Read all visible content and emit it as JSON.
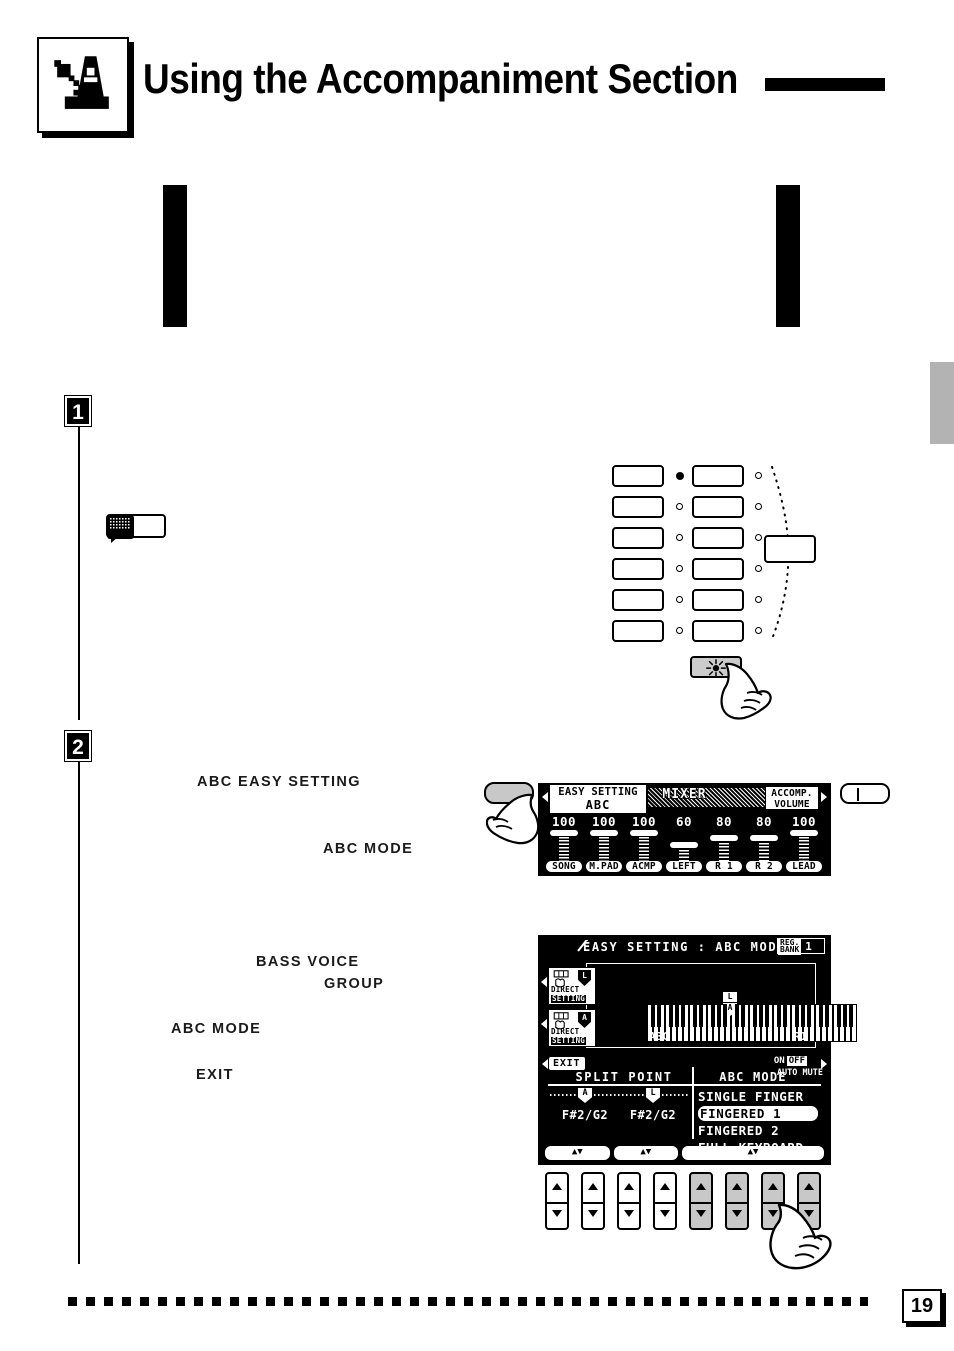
{
  "header": {
    "title": "Using the Accompaniment Section",
    "icon": "metronome-icon"
  },
  "footer": {
    "page_number": "19"
  },
  "steps": [
    {
      "number": "1"
    },
    {
      "number": "2"
    }
  ],
  "labels": {
    "abc_easy_setting": "ABC EASY SETTING",
    "abc_mode_1": "ABC MODE",
    "bass_voice": "BASS VOICE",
    "group": "GROUP",
    "abc_mode_2": "ABC MODE",
    "exit": "EXIT"
  },
  "mixer_lcd": {
    "title": "MIXER",
    "easy_setting": {
      "line1": "EASY SETTING",
      "line2": "ABC"
    },
    "accomp_volume": {
      "line1": "ACCOMP.",
      "line2": "VOLUME"
    },
    "channels": [
      {
        "name": "SONG",
        "value": "100"
      },
      {
        "name": "M.PAD",
        "value": "100"
      },
      {
        "name": "ACMP",
        "value": "100"
      },
      {
        "name": "LEFT",
        "value": "60"
      },
      {
        "name": "R 1",
        "value": "80"
      },
      {
        "name": "R 2",
        "value": "80"
      },
      {
        "name": "LEAD",
        "value": "100"
      }
    ]
  },
  "easy_setting_lcd": {
    "title": "EASY SETTING : ABC MODE",
    "reg_bank": {
      "label_line1": "REG.",
      "label_line2": "BANK",
      "value": "1"
    },
    "direct_setting_top": {
      "line1": "DIRECT",
      "line2": "SETTING",
      "marker": "L"
    },
    "direct_setting_bottom": {
      "line1": "DIRECT",
      "line2": "SETTING",
      "marker": "A"
    },
    "keyboard": {
      "split_marker_top": "L",
      "split_marker_bottom": "A",
      "left_zone_label": "ABC",
      "right_zone_label": "R1"
    },
    "exit_button": "EXIT",
    "auto_mute": {
      "on": "ON",
      "off": "OFF",
      "label": "AUTO MUTE"
    },
    "split_point": {
      "heading": "SPLIT POINT",
      "columns": [
        {
          "flag": "A",
          "note": "F#2/G2"
        },
        {
          "flag": "L",
          "note": "F#2/G2"
        }
      ]
    },
    "abc_mode": {
      "heading": "ABC MODE",
      "options": [
        "SINGLE FINGER",
        "FINGERED 1",
        "FINGERED 2",
        "FULL KEYBOARD"
      ],
      "selected": "FINGERED 1"
    },
    "button_strip": [
      "▲▼",
      "▲▼",
      "▲▼"
    ]
  },
  "panel_diagram": {
    "note": "style/voice selector buttons with indicator lamps",
    "highlight_button": "accompaniment-button"
  }
}
